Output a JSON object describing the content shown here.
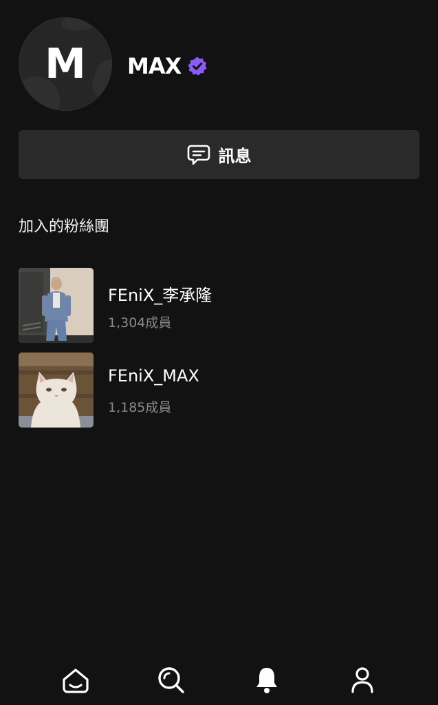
{
  "profile": {
    "avatar_letter": "M",
    "name": "MAX",
    "verified_color": "#8a5cf6"
  },
  "message_button": {
    "label": "訊息",
    "icon": "message-icon"
  },
  "joined_section": {
    "title": "加入的粉絲團",
    "items": [
      {
        "name": "FEniX_李承隆",
        "members": "1,304成員",
        "thumbnail": "person-photo"
      },
      {
        "name": "FEniX_MAX",
        "members": "1,185成員",
        "thumbnail": "white-cat-photo"
      }
    ]
  },
  "bottom_nav": {
    "items": [
      {
        "icon": "home-icon"
      },
      {
        "icon": "search-icon"
      },
      {
        "icon": "bell-icon"
      },
      {
        "icon": "profile-icon"
      }
    ]
  }
}
